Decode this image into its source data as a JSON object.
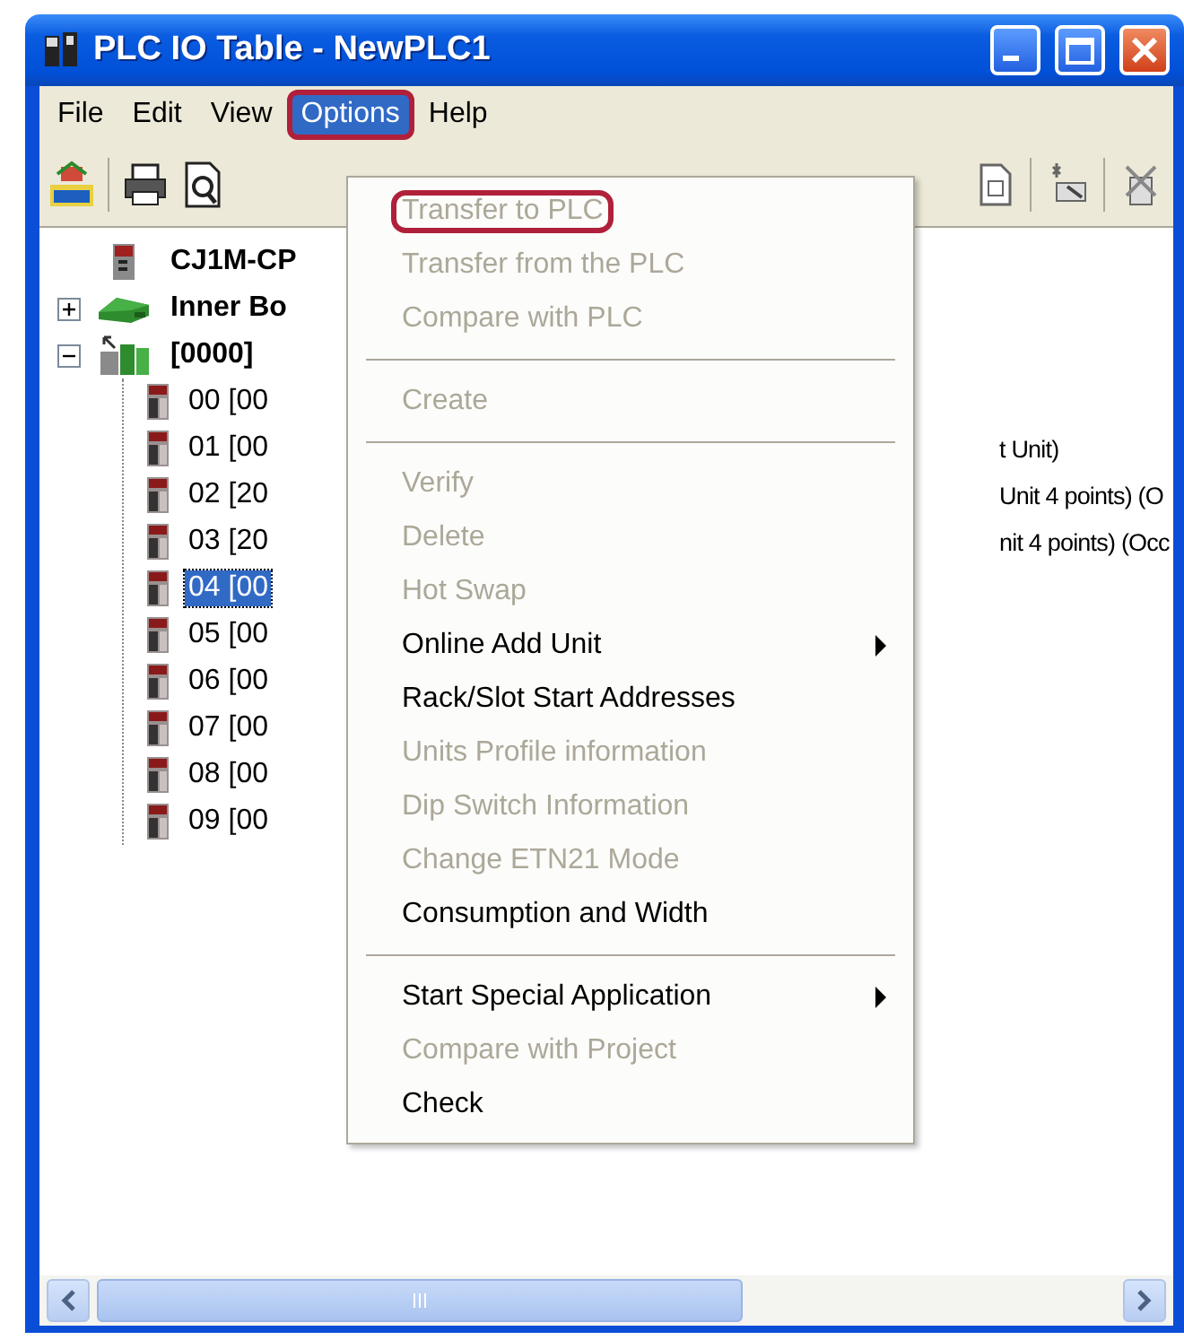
{
  "window": {
    "title": "PLC IO Table - NewPLC1"
  },
  "menu_bar": [
    {
      "label": "File",
      "selected": false,
      "marked": false
    },
    {
      "label": "Edit",
      "selected": false,
      "marked": false
    },
    {
      "label": "View",
      "selected": false,
      "marked": false
    },
    {
      "label": "Options",
      "selected": true,
      "marked": true
    },
    {
      "label": "Help",
      "selected": false,
      "marked": false
    }
  ],
  "tree": [
    {
      "label": "CJ1M-CP",
      "kind": "cpu",
      "selected": false
    },
    {
      "label": "Inner Bo",
      "kind": "board",
      "selected": false,
      "expanded": false
    },
    {
      "label": "[0000]",
      "kind": "rack",
      "selected": false,
      "expanded": true,
      "children": [
        {
          "label": "00 [00",
          "kind": "unit",
          "selected": false
        },
        {
          "label": "01 [00",
          "kind": "unit",
          "selected": false,
          "detail": "t Unit)"
        },
        {
          "label": "02 [20",
          "kind": "unit",
          "selected": false,
          "detail": "Unit 4 points) (O"
        },
        {
          "label": "03 [20",
          "kind": "unit",
          "selected": false,
          "detail": "nit 4 points) (Occ"
        },
        {
          "label": "04 [00",
          "kind": "unit",
          "selected": true
        },
        {
          "label": "05 [00",
          "kind": "unit",
          "selected": false
        },
        {
          "label": "06 [00",
          "kind": "unit",
          "selected": false
        },
        {
          "label": "07 [00",
          "kind": "unit",
          "selected": false
        },
        {
          "label": "08 [00",
          "kind": "unit",
          "selected": false
        },
        {
          "label": "09 [00",
          "kind": "unit",
          "selected": false
        }
      ]
    }
  ],
  "options_menu": [
    {
      "kind": "item",
      "label": "Transfer to PLC",
      "disabled": true,
      "submenu": false,
      "marked": true
    },
    {
      "kind": "item",
      "label": "Transfer from the PLC",
      "disabled": true,
      "submenu": false,
      "marked": false
    },
    {
      "kind": "item",
      "label": "Compare with PLC",
      "disabled": true,
      "submenu": false,
      "marked": false
    },
    {
      "kind": "separator"
    },
    {
      "kind": "item",
      "label": "Create",
      "disabled": true,
      "submenu": false,
      "marked": false
    },
    {
      "kind": "separator"
    },
    {
      "kind": "item",
      "label": "Verify",
      "disabled": true,
      "submenu": false,
      "marked": false
    },
    {
      "kind": "item",
      "label": "Delete",
      "disabled": true,
      "submenu": false,
      "marked": false
    },
    {
      "kind": "item",
      "label": "Hot Swap",
      "disabled": true,
      "submenu": false,
      "marked": false
    },
    {
      "kind": "item",
      "label": "Online Add Unit",
      "disabled": false,
      "submenu": true,
      "marked": false
    },
    {
      "kind": "item",
      "label": "Rack/Slot Start Addresses",
      "disabled": false,
      "submenu": false,
      "marked": false
    },
    {
      "kind": "item",
      "label": "Units Profile information",
      "disabled": true,
      "submenu": false,
      "marked": false
    },
    {
      "kind": "item",
      "label": "Dip Switch Information",
      "disabled": true,
      "submenu": false,
      "marked": false
    },
    {
      "kind": "item",
      "label": "Change ETN21 Mode",
      "disabled": true,
      "submenu": false,
      "marked": false
    },
    {
      "kind": "item",
      "label": "Consumption and Width",
      "disabled": false,
      "submenu": false,
      "marked": false
    },
    {
      "kind": "separator"
    },
    {
      "kind": "item",
      "label": "Start Special Application",
      "disabled": false,
      "submenu": true,
      "marked": false
    },
    {
      "kind": "item",
      "label": "Compare with Project",
      "disabled": true,
      "submenu": false,
      "marked": false
    },
    {
      "kind": "item",
      "label": "Check",
      "disabled": false,
      "submenu": false,
      "marked": false
    }
  ]
}
